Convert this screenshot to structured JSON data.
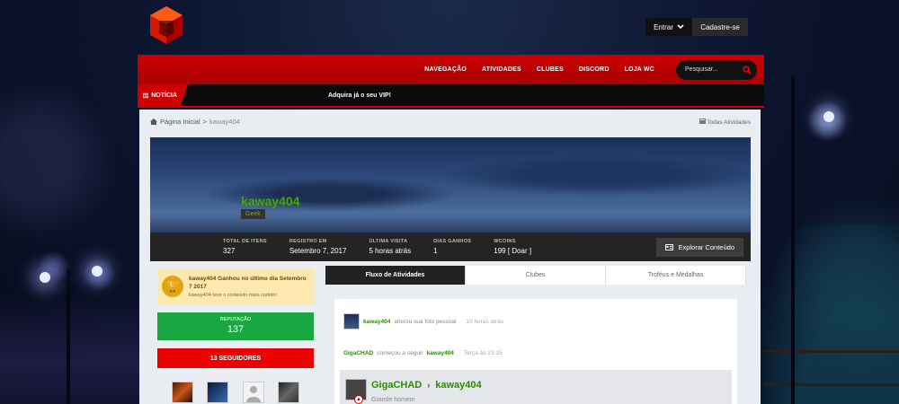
{
  "colors": {
    "brand_red": "#cc0000",
    "username_green": "#44a800",
    "reputation_green": "#18a741",
    "link_green": "#2e8b00"
  },
  "auth": {
    "login_label": "Entrar",
    "register_label": "Cadastre-se"
  },
  "nav": {
    "items": [
      "NAVEGAÇÃO",
      "ATIVIDADES",
      "CLUBES",
      "DISCORD",
      "LOJA WC"
    ],
    "search_placeholder": "Pesquisar..."
  },
  "news": {
    "badge": "NOTÍCIA",
    "text": "Adquira já o seu VIP!"
  },
  "breadcrumb": {
    "home": "Página Inicial",
    "separator": ">",
    "current": "kaway404",
    "all_activity": "Todas Atividades"
  },
  "profile": {
    "username": "kaway404",
    "group": "Geek",
    "stats": [
      {
        "label": "TOTAL DE ITENS",
        "value": "327"
      },
      {
        "label": "REGISTRO EM",
        "value": "Setembro 7, 2017"
      },
      {
        "label": "ÚLTIMA VISITA",
        "value": "5 horas atrás"
      },
      {
        "label": "DIAS GANHOS",
        "value": "1"
      },
      {
        "label": "WCOINS",
        "value": "199 [ Doar ]"
      }
    ],
    "explore_label": "Explorar Conteúdo"
  },
  "sidebar": {
    "achievement_title": "kaway404 Ganhou no último dia Setembro 7 2017",
    "achievement_sub": "kaway404 teve o conteúdo mais curtido!",
    "reputation_label": "REPUTAÇÃO",
    "reputation_value": "137",
    "followers_label": "13 SEGUIDORES"
  },
  "tabs": [
    "Fluxo de Atividades",
    "Clubes",
    "Troféus e Medalhas"
  ],
  "feed": {
    "item1": {
      "user": "kaway404",
      "action": "alterou sua foto pessoal",
      "time": "10 horas atrás"
    },
    "item2": {
      "user": "GigaCHAD",
      "action": "começou a seguir",
      "target": "kaway404",
      "time": "Terça às 23:15"
    },
    "post": {
      "from": "GigaCHAD",
      "arrow": "›",
      "to": "kaway404",
      "body": "Grande homem"
    }
  }
}
